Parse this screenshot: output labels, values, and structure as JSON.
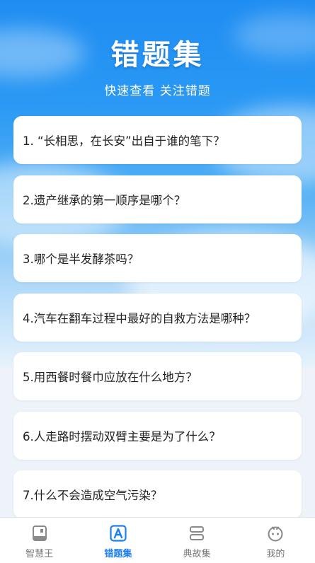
{
  "header": {
    "title": "错题集",
    "subtitle": "快速查看 关注错题"
  },
  "questions": [
    {
      "text": "1. “长相思，在长安”出自于谁的笔下？"
    },
    {
      "text": "2.遗产继承的第一顺序是哪个？"
    },
    {
      "text": "3.哪个是半发酵茶吗？"
    },
    {
      "text": "4.汽车在翻车过程中最好的自救方法是哪种？"
    },
    {
      "text": "5.用西餐时餐巾应放在什么地方？"
    },
    {
      "text": "6.人走路时摆动双臂主要是为了什么？"
    },
    {
      "text": "7.什么不会造成空气污染？"
    }
  ],
  "tabbar": {
    "active_color": "#1e7ff0",
    "inactive_color": "#777777",
    "items": [
      {
        "label": "智慧王",
        "icon": "book-icon",
        "active": false
      },
      {
        "label": "错题集",
        "icon": "letter-a-icon",
        "active": true
      },
      {
        "label": "典故集",
        "icon": "stack-icon",
        "active": false
      },
      {
        "label": "我的",
        "icon": "face-icon",
        "active": false
      }
    ]
  }
}
